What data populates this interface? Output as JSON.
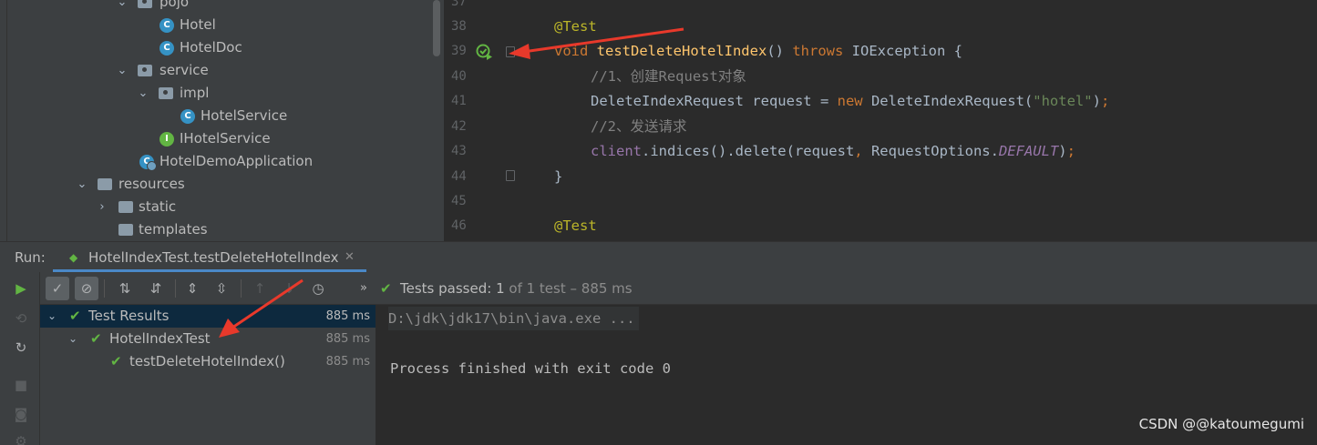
{
  "project_tree": {
    "items": [
      {
        "label": "pojo",
        "type": "package",
        "expanded": true
      },
      {
        "label": "Hotel",
        "type": "class"
      },
      {
        "label": "HotelDoc",
        "type": "class"
      },
      {
        "label": "service",
        "type": "package",
        "expanded": true
      },
      {
        "label": "impl",
        "type": "package",
        "expanded": true
      },
      {
        "label": "HotelService",
        "type": "class"
      },
      {
        "label": "IHotelService",
        "type": "interface"
      },
      {
        "label": "HotelDemoApplication",
        "type": "application"
      },
      {
        "label": "resources",
        "type": "resources-folder",
        "expanded": true
      },
      {
        "label": "static",
        "type": "folder",
        "expanded": false
      },
      {
        "label": "templates",
        "type": "folder"
      }
    ]
  },
  "editor": {
    "line_numbers": [
      "37",
      "38",
      "39",
      "40",
      "41",
      "42",
      "43",
      "44",
      "45",
      "46"
    ],
    "lines": {
      "l38_annotation": "@Test",
      "l39_void": "void",
      "l39_method": "testDeleteHotelIndex",
      "l39_parens": "()",
      "l39_throws": "throws",
      "l39_exception": "IOException {",
      "l40_comment": "//1、创建Request对象",
      "l41_type": "DeleteIndexRequest request = ",
      "l41_new": "new",
      "l41_ctor": " DeleteIndexRequest(",
      "l41_str": "\"hotel\"",
      "l41_end": ")",
      "l41_semi": ";",
      "l42_comment": "//2、发送请求",
      "l43_client": "client",
      "l43_call": ".indices().delete(request",
      "l43_comma": ",",
      "l43_opts": " RequestOptions.",
      "l43_default": "DEFAULT",
      "l43_end": ")",
      "l43_semi": ";",
      "l44_brace": "}",
      "l46_annotation": "@Test"
    }
  },
  "run_panel": {
    "label": "Run:",
    "tab_title": "HotelIndexTest.testDeleteHotelIndex",
    "status_prefix": "Tests passed:",
    "status_count": "1",
    "status_detail": "of 1 test – 885 ms",
    "test_tree": [
      {
        "label": "Test Results",
        "time": "885 ms"
      },
      {
        "label": "HotelIndexTest",
        "time": "885 ms"
      },
      {
        "label": "testDeleteHotelIndex()",
        "time": "885 ms"
      }
    ],
    "console": {
      "command": "D:\\jdk\\jdk17\\bin\\java.exe ...",
      "exit_message": "Process finished with exit code 0"
    }
  },
  "watermark": "CSDN @@katoumegumi",
  "colors": {
    "accent": "#4a88c7",
    "pass_green": "#62b543",
    "annotation_arrow": "#e8392b"
  }
}
